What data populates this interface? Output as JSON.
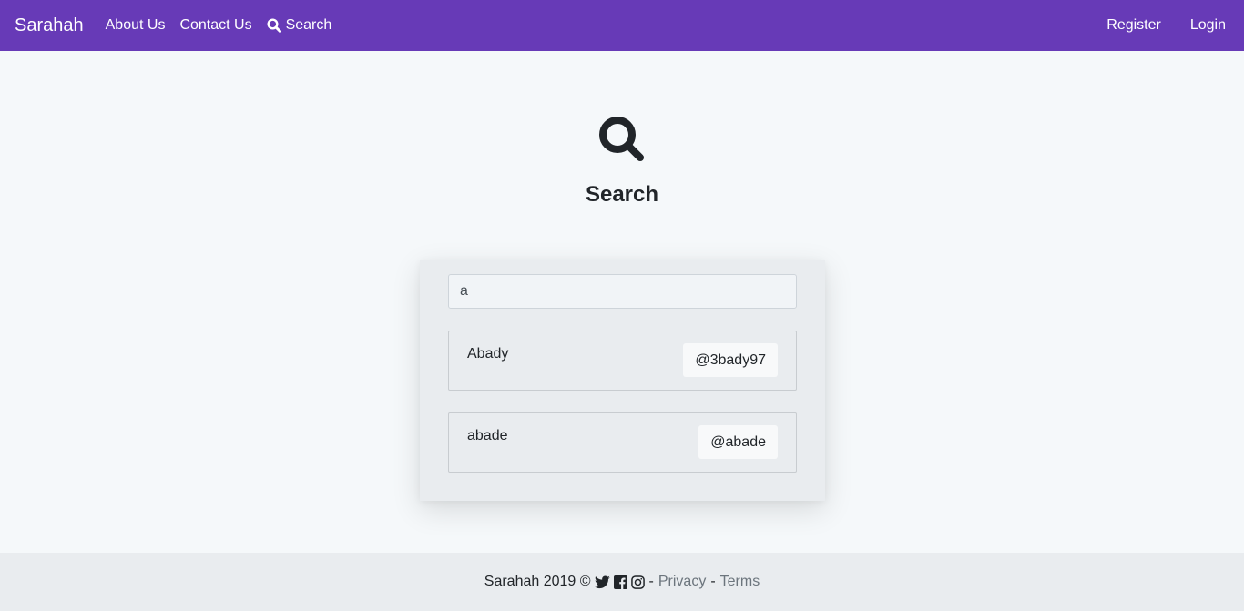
{
  "navbar": {
    "brand": "Sarahah",
    "links": [
      "About Us",
      "Contact Us",
      "Search"
    ],
    "right_links": [
      "Register",
      "Login"
    ],
    "color": "#673ab7"
  },
  "hero": {
    "icon": "search-icon",
    "title": "Search"
  },
  "search": {
    "value": "a"
  },
  "results": [
    {
      "name": "Abady",
      "handle": "@3bady97"
    },
    {
      "name": "abade",
      "handle": "@abade"
    }
  ],
  "footer": {
    "text": "Sarahah 2019 ©",
    "icons": [
      "twitter-icon",
      "facebook-icon",
      "instagram-icon"
    ],
    "separator": "-",
    "privacy": "Privacy",
    "terms": "Terms"
  }
}
